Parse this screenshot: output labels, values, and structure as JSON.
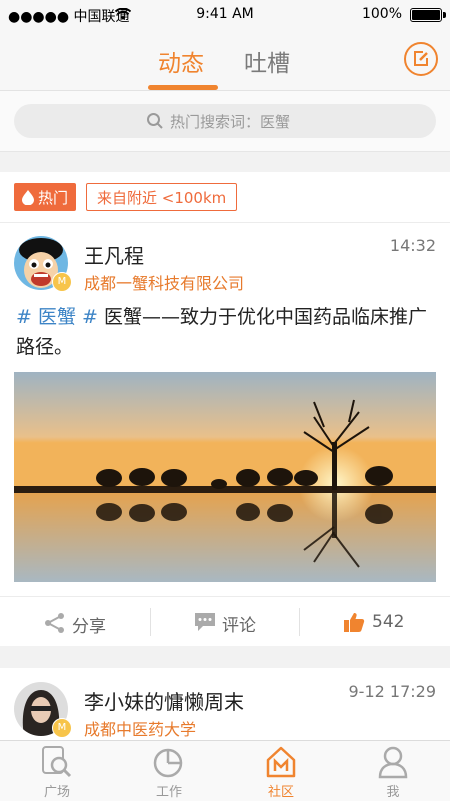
{
  "status_bar": {
    "carrier": "●●●●● 中国联通",
    "time": "9:41 AM",
    "battery": "100%"
  },
  "header": {
    "tabs": [
      {
        "label": "动态",
        "active": true
      },
      {
        "label": "吐槽",
        "active": false
      }
    ],
    "compose_icon": "edit-icon"
  },
  "search": {
    "placeholder": "热门搜索词：医蟹"
  },
  "filters": {
    "hot_label": "热门",
    "nearby_label": "来自附近 <100km"
  },
  "posts": [
    {
      "author": "王凡程",
      "org": "成都一蟹科技有限公司",
      "time": "14:32",
      "hashtag": "# 医蟹 #",
      "text": " 医蟹——致力于优化中国药品临床推广路径。",
      "image": "sunset-elephants-photo",
      "actions": {
        "share": "分享",
        "comment": "评论",
        "likes": "542"
      }
    },
    {
      "author": "李小妹的慵懒周末",
      "org": "成都中医药大学",
      "time": "9-12 17:29"
    }
  ],
  "tab_bar": [
    {
      "label": "广场",
      "icon": "search-magnifier-icon",
      "active": false
    },
    {
      "label": "工作",
      "icon": "pie-chart-icon",
      "active": false
    },
    {
      "label": "社区",
      "icon": "house-m-icon",
      "active": true
    },
    {
      "label": "我",
      "icon": "person-icon",
      "active": false
    }
  ],
  "colors": {
    "accent": "#f0842f",
    "hot_tag": "#ef6b3c",
    "hashtag": "#3d84c6"
  }
}
